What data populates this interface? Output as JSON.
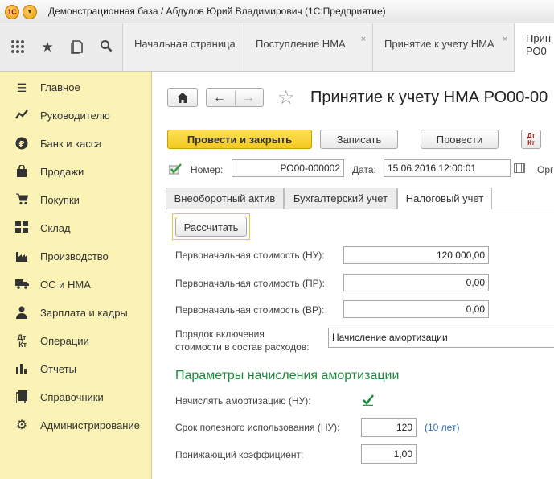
{
  "window": {
    "title": "Демонстрационная база / Абдулов Юрий Владимирович  (1С:Предприятие)",
    "logo": "1С"
  },
  "toolbar": {
    "icons": [
      "apps-grid-icon",
      "star-icon",
      "history-icon",
      "search-icon"
    ]
  },
  "tabs": [
    {
      "label": "Начальная страница",
      "closable": false
    },
    {
      "label": "Поступление НМА",
      "closable": true
    },
    {
      "label": "Принятие к учету НМА",
      "closable": true
    },
    {
      "label_line1": "Прин",
      "label_line2": "РО0",
      "active": true
    }
  ],
  "sidebar": {
    "items": [
      {
        "label": "Главное",
        "icon": "list-icon"
      },
      {
        "label": "Руководителю",
        "icon": "chart-line-icon"
      },
      {
        "label": "Банк и касса",
        "icon": "ruble-coin-icon"
      },
      {
        "label": "Продажи",
        "icon": "shopping-bag-icon"
      },
      {
        "label": "Покупки",
        "icon": "cart-icon"
      },
      {
        "label": "Склад",
        "icon": "warehouse-icon"
      },
      {
        "label": "Производство",
        "icon": "factory-icon"
      },
      {
        "label": "ОС и НМА",
        "icon": "truck-icon"
      },
      {
        "label": "Зарплата и кадры",
        "icon": "person-icon"
      },
      {
        "label": "Операции",
        "icon": "dt-kt-icon"
      },
      {
        "label": "Отчеты",
        "icon": "bar-chart-icon"
      },
      {
        "label": "Справочники",
        "icon": "book-icon"
      },
      {
        "label": "Администрирование",
        "icon": "gear-icon"
      }
    ]
  },
  "document": {
    "title": "Принятие к учету НМА РО00-00",
    "buttons": {
      "post_and_close": "Провести и закрыть",
      "save": "Записать",
      "post": "Провести",
      "dtkt": "Дт Кт"
    },
    "number_label": "Номер:",
    "number_value": "РО00-000002",
    "date_label": "Дата:",
    "date_value": "15.06.2016 12:00:01",
    "org_label": "Орг",
    "form_tabs": [
      "Внеоборотный актив",
      "Бухгалтерский учет",
      "Налоговый учет"
    ],
    "active_form_tab": 2,
    "calculate_button": "Рассчитать",
    "fields": {
      "initial_cost_nu_label": "Первоначальная стоимость (НУ):",
      "initial_cost_nu_value": "120 000,00",
      "initial_cost_pr_label": "Первоначальная стоимость (ПР):",
      "initial_cost_pr_value": "0,00",
      "initial_cost_vr_label": "Первоначальная стоимость (ВР):",
      "initial_cost_vr_value": "0,00",
      "expense_order_label_line1": "Порядок включения",
      "expense_order_label_line2": "стоимости в состав расходов:",
      "expense_order_value": "Начисление амортизации"
    },
    "amortization": {
      "section_title": "Параметры начисления амортизации",
      "charge_label": "Начислять амортизацию (НУ):",
      "charge_checked": true,
      "useful_life_label": "Срок полезного использования (НУ):",
      "useful_life_value": "120",
      "useful_life_hint": "(10 лет)",
      "reducing_coef_label": "Понижающий коэффициент:",
      "reducing_coef_value": "1,00"
    }
  },
  "colors": {
    "sidebar_bg": "#fbf2b5",
    "primary_button": "#f4c81b",
    "section_title": "#1c8a3c",
    "link": "#2a6fb0"
  }
}
